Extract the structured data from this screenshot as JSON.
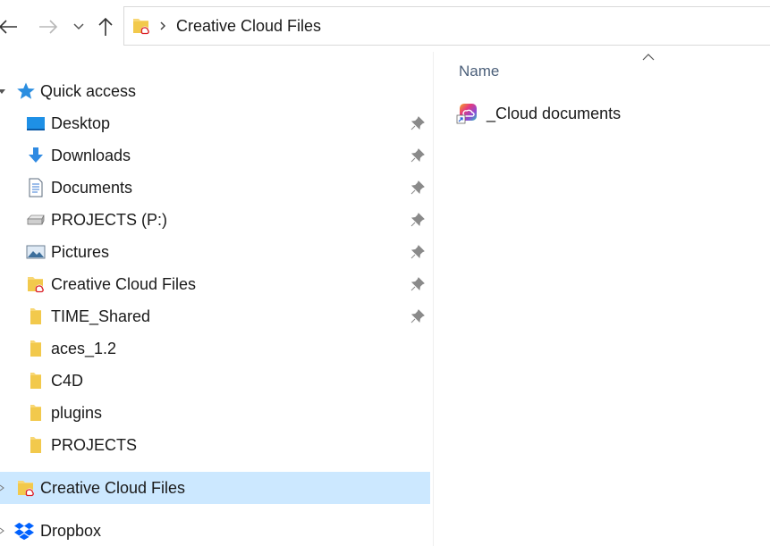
{
  "address": {
    "folder_icon": "creative-cloud-folder-icon",
    "path": "Creative Cloud Files"
  },
  "nav": {
    "quick_access": {
      "label": "Quick access",
      "icon": "star-icon",
      "items": [
        {
          "label": "Desktop",
          "icon": "desktop-icon",
          "pinned": true
        },
        {
          "label": "Downloads",
          "icon": "download-arrow-icon",
          "pinned": true
        },
        {
          "label": "Documents",
          "icon": "documents-icon",
          "pinned": true
        },
        {
          "label": "PROJECTS (P:)",
          "icon": "network-drive-icon",
          "pinned": true
        },
        {
          "label": "Pictures",
          "icon": "pictures-icon",
          "pinned": true
        },
        {
          "label": "Creative Cloud Files",
          "icon": "creative-cloud-folder-icon",
          "pinned": true
        },
        {
          "label": "TIME_Shared",
          "icon": "folder-icon",
          "pinned": true
        },
        {
          "label": "aces_1.2",
          "icon": "folder-icon",
          "pinned": false
        },
        {
          "label": "C4D",
          "icon": "folder-icon",
          "pinned": false
        },
        {
          "label": "plugins",
          "icon": "folder-icon",
          "pinned": false
        },
        {
          "label": "PROJECTS",
          "icon": "folder-icon",
          "pinned": false
        }
      ]
    },
    "creative_cloud": {
      "label": "Creative Cloud Files",
      "icon": "creative-cloud-folder-icon",
      "selected": true
    },
    "dropbox": {
      "label": "Dropbox",
      "icon": "dropbox-icon"
    }
  },
  "content": {
    "column_header": "Name",
    "sort": "ascending",
    "files": [
      {
        "label": "_Cloud documents",
        "icon": "cloud-documents-shortcut-icon"
      }
    ]
  },
  "colors": {
    "selected_row": "#cce8ff",
    "column_header_text": "#4c607a",
    "folder_yellow": "#f8d775",
    "accent_blue": "#1e90e6"
  }
}
